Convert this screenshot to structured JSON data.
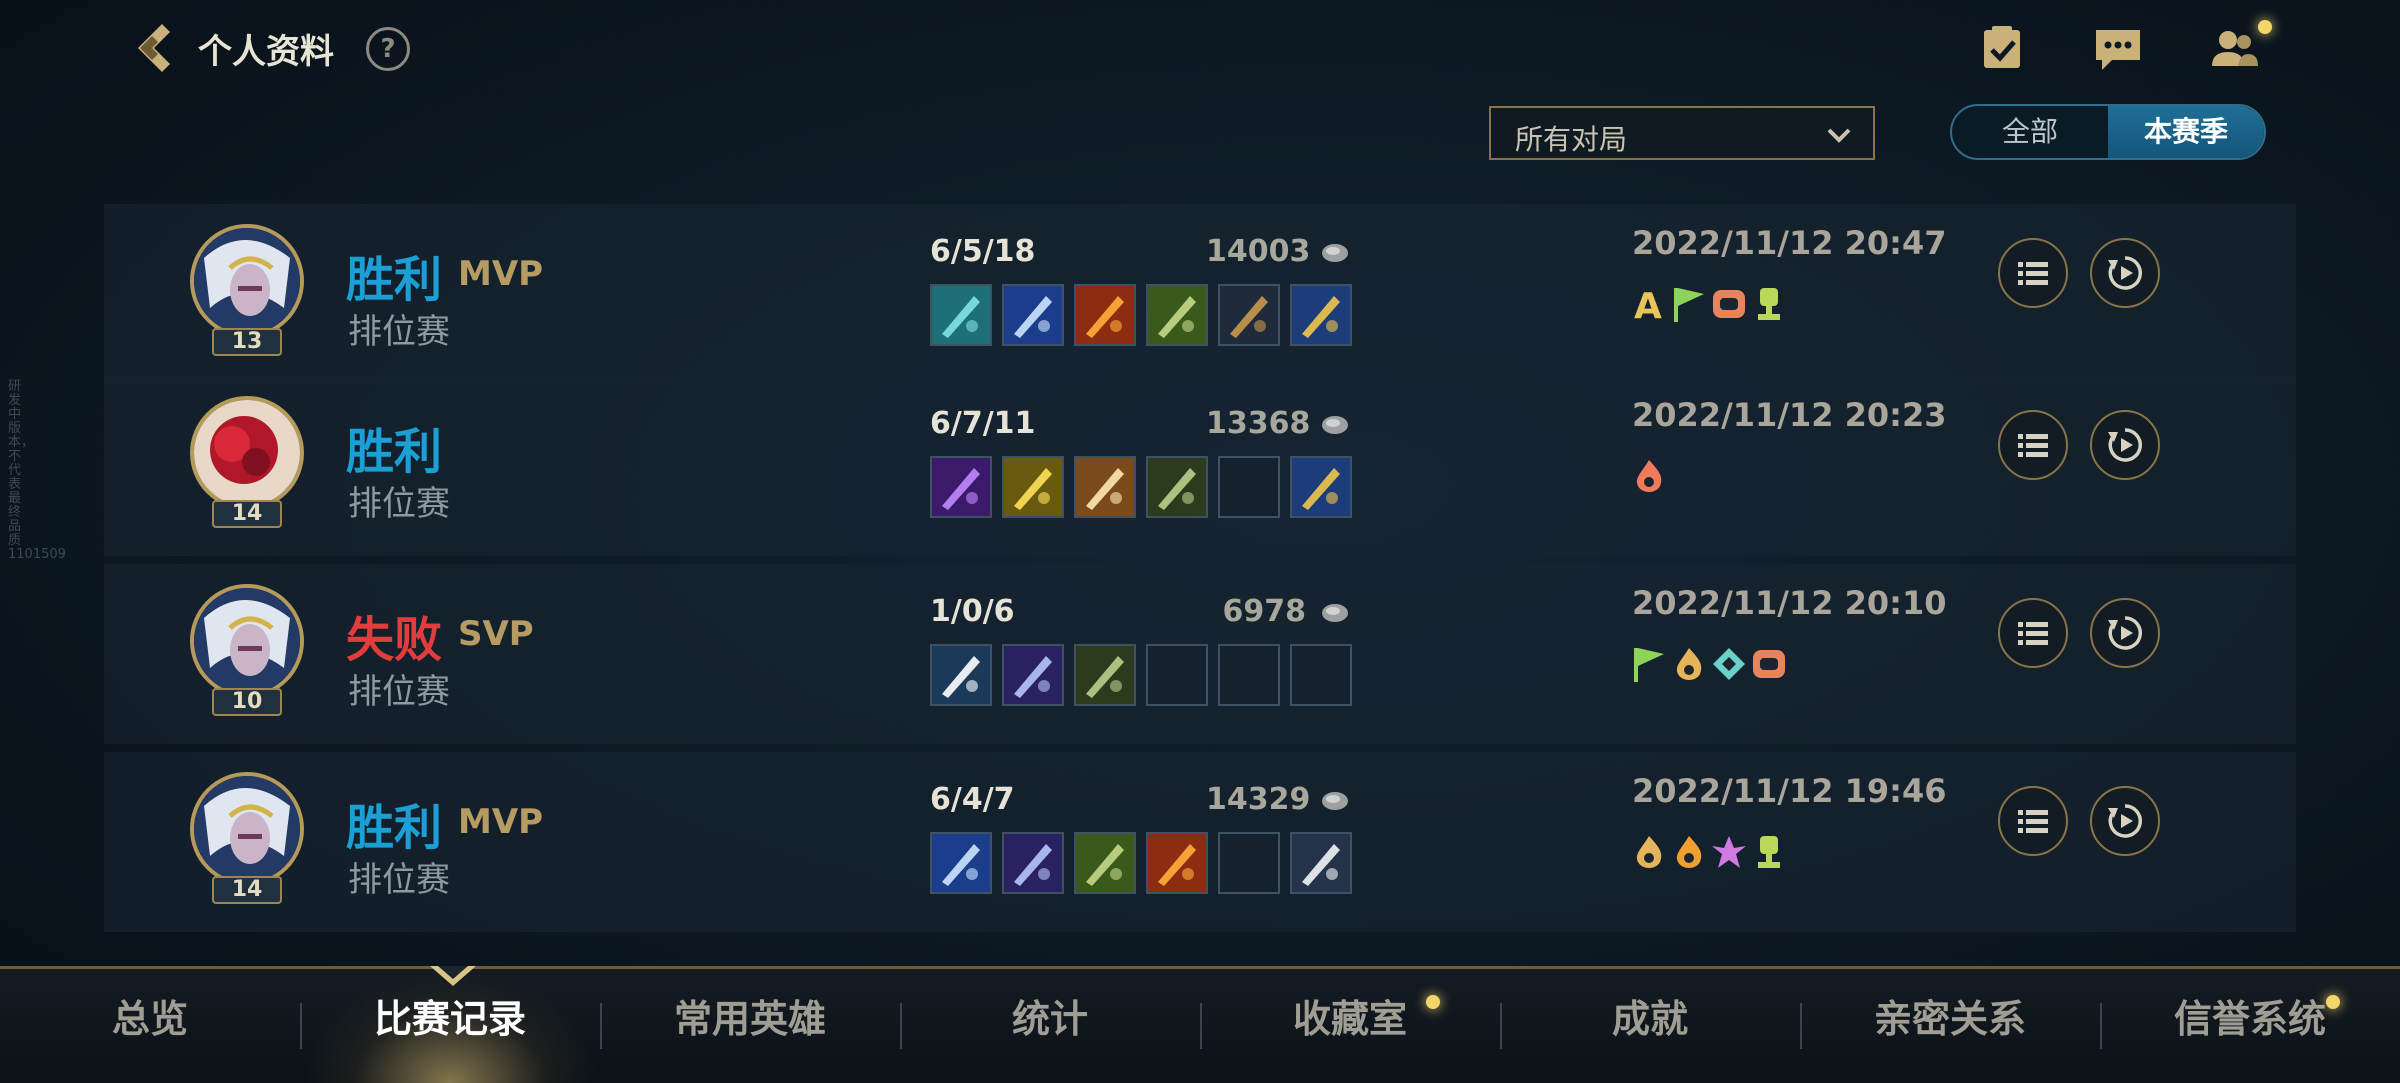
{
  "header": {
    "title": "个人资料",
    "help_label": "?",
    "icons": [
      "back-icon",
      "help-icon",
      "tasks-icon",
      "chat-icon",
      "friends-icon"
    ]
  },
  "filter": {
    "selected": "所有对局",
    "icon": "chevron-down-icon"
  },
  "season_toggle": {
    "options": [
      "全部",
      "本赛季"
    ],
    "selected": "本赛季"
  },
  "colors": {
    "win": "#1b9fd4",
    "loss": "#e23c3c",
    "gold_accent": "#b69c62",
    "notification": "#f4d56a"
  },
  "matches": [
    {
      "result": "胜利",
      "result_type": "win",
      "badge": "MVP",
      "mode": "排位赛",
      "level": "13",
      "kda": "6/5/18",
      "gold": "14003",
      "datetime": "2022/11/12 20:47",
      "champion": "white-haired-champion",
      "items": [
        "item-cyan-relic",
        "item-blue-blade",
        "item-flame-cleaver",
        "item-green-claw",
        "item-bow",
        "item-golden-trinket"
      ],
      "tags": [
        "rank-a",
        "flag",
        "chain",
        "trophy"
      ]
    },
    {
      "result": "胜利",
      "result_type": "win",
      "badge": "",
      "mode": "排位赛",
      "level": "14",
      "kda": "6/7/11",
      "gold": "13368",
      "datetime": "2022/11/12 20:23",
      "champion": "red-haired-champion",
      "items": [
        "item-purple-sword",
        "item-yellow-shield",
        "item-radiant-wings",
        "item-green-spear",
        "empty",
        "item-golden-trinket"
      ],
      "tags": [
        "demon"
      ]
    },
    {
      "result": "失败",
      "result_type": "loss",
      "badge": "SVP",
      "mode": "排位赛",
      "level": "10",
      "kda": "1/0/6",
      "gold": "6978",
      "datetime": "2022/11/12 20:10",
      "champion": "white-haired-champion",
      "items": [
        "item-ice-blade",
        "item-purple-shuriken",
        "item-green-spear",
        "empty",
        "empty",
        "empty"
      ],
      "tags": [
        "flag",
        "flame-hand",
        "diamond",
        "chain"
      ]
    },
    {
      "result": "胜利",
      "result_type": "win",
      "badge": "MVP",
      "mode": "排位赛",
      "level": "14",
      "kda": "6/4/7",
      "gold": "14329",
      "datetime": "2022/11/12 19:46",
      "champion": "white-haired-champion",
      "items": [
        "item-blue-blade",
        "item-purple-shuriken",
        "item-green-claw",
        "item-flame-cleaver",
        "empty",
        "item-white-shard"
      ],
      "tags": [
        "flame-hand",
        "fire",
        "cross",
        "trophy"
      ]
    }
  ],
  "tabs": [
    {
      "label": "总览",
      "active": false,
      "notify": false
    },
    {
      "label": "比赛记录",
      "active": true,
      "notify": false
    },
    {
      "label": "常用英雄",
      "active": false,
      "notify": false
    },
    {
      "label": "统计",
      "active": false,
      "notify": false
    },
    {
      "label": "收藏室",
      "active": false,
      "notify": true
    },
    {
      "label": "成就",
      "active": false,
      "notify": false
    },
    {
      "label": "亲密关系",
      "active": false,
      "notify": false
    },
    {
      "label": "信誉系统",
      "active": false,
      "notify": true
    }
  ],
  "side_note": "研发中版本，不代表最终品质 1101509"
}
